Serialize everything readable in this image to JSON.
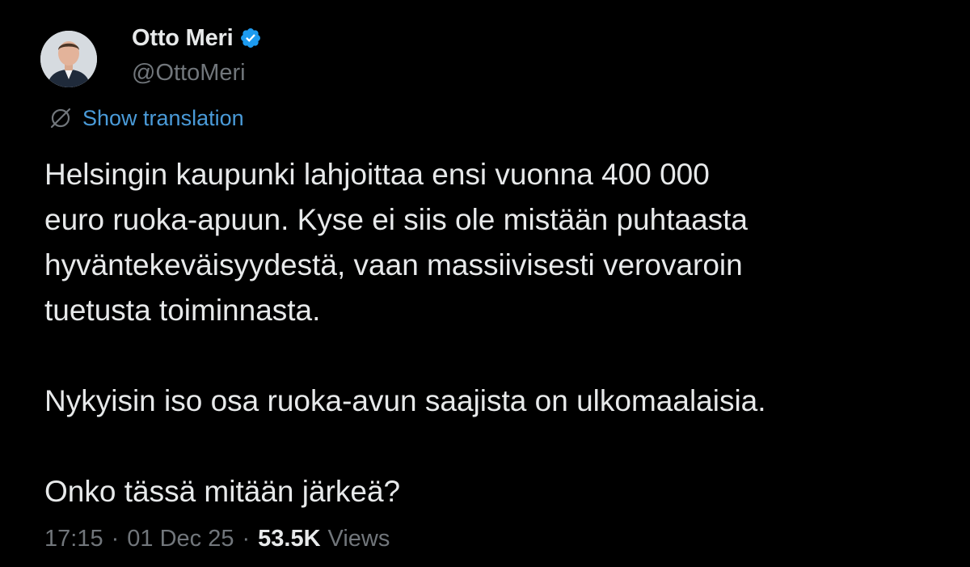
{
  "author": {
    "display_name": "Otto Meri",
    "handle": "@OttoMeri",
    "verified": true,
    "avatar_icon": "profile-photo"
  },
  "translation": {
    "icon": "globe-icon",
    "label": "Show translation"
  },
  "tweet": {
    "paragraphs": [
      "Helsingin kaupunki lahjoittaa ensi vuonna 400 000\neuro ruoka-apuun. Kyse ei siis ole mistään puhtaasta\nhyväntekeväisyydestä, vaan massiivisesti verovaroin\ntuetusta toiminnasta.",
      "Nykyisin iso osa ruoka-avun saajista on ulkomaalaisia.",
      "Onko tässä mitään järkeä?"
    ]
  },
  "meta": {
    "time": "17:15",
    "separator": "·",
    "date": "01 Dec 25",
    "views_count": "53.5K",
    "views_label": "Views"
  },
  "colors": {
    "background": "#000000",
    "primary_text": "#e7e9ea",
    "secondary_text": "#71767b",
    "link": "#4a9bd9",
    "verified": "#1d9bf0"
  }
}
